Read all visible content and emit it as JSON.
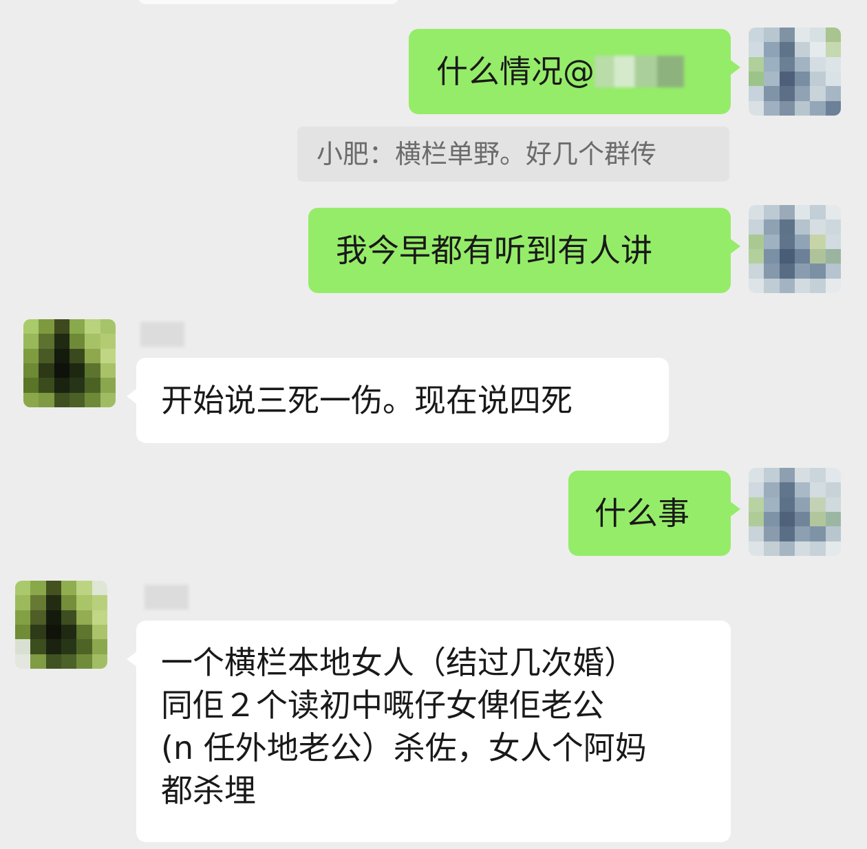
{
  "messages": [
    {
      "id": "m1",
      "side": "me",
      "text": "什么情况@",
      "mention_redacted": true
    },
    {
      "id": "q1",
      "type": "quote",
      "text": "小肥：横栏单野。好几个群传"
    },
    {
      "id": "m2",
      "side": "me",
      "text": "我今早都有听到有人讲"
    },
    {
      "id": "m3",
      "side": "other",
      "text": "开始说三死一伤。现在说四死"
    },
    {
      "id": "m4",
      "side": "me",
      "text": "什么事"
    },
    {
      "id": "m5",
      "side": "other",
      "lines": [
        "一个横栏本地女人（结过几次婚）",
        "同佢２个读初中嘅仔女俾佢老公",
        "(n 任外地老公）杀佐，女人个阿妈",
        "都杀埋"
      ]
    }
  ],
  "colors": {
    "background": "#ededed",
    "me_bubble": "#95ec69",
    "other_bubble": "#ffffff",
    "quote_bg": "#e3e3e3"
  }
}
